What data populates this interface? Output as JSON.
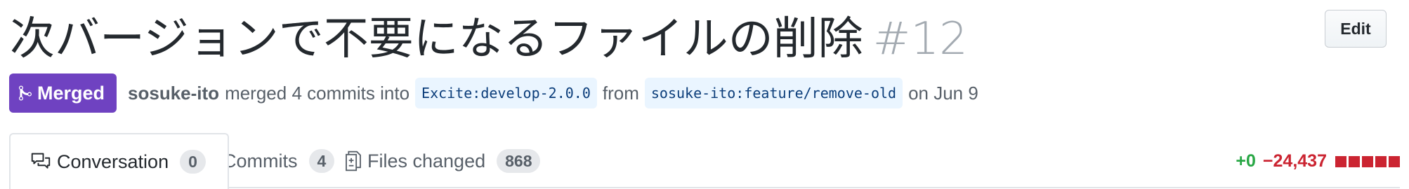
{
  "pr": {
    "title": "次バージョンで不要になるファイルの削除",
    "number": "#12",
    "edit_label": "Edit",
    "state_label": "Merged",
    "author": "sosuke-ito",
    "action_text": "merged 4 commits into",
    "base_branch": "Excite:develop-2.0.0",
    "from_text": "from",
    "head_branch": "sosuke-ito:feature/remove-old",
    "date_text": "on Jun 9"
  },
  "tabs": [
    {
      "label": "Conversation",
      "count": "0",
      "icon": "comment-discussion-icon"
    },
    {
      "label": "Commits",
      "count": "4",
      "icon": "git-commit-icon"
    },
    {
      "label": "Files changed",
      "count": "868",
      "icon": "file-diff-icon"
    }
  ],
  "diffstat": {
    "additions": "+0",
    "deletions": "−24,437",
    "blocks_deleted": 5,
    "blocks_added": 0
  },
  "colors": {
    "merged": "#6f42c1",
    "additions": "#28a745",
    "deletions": "#cb2431",
    "branch_bg": "#eaf5ff"
  }
}
